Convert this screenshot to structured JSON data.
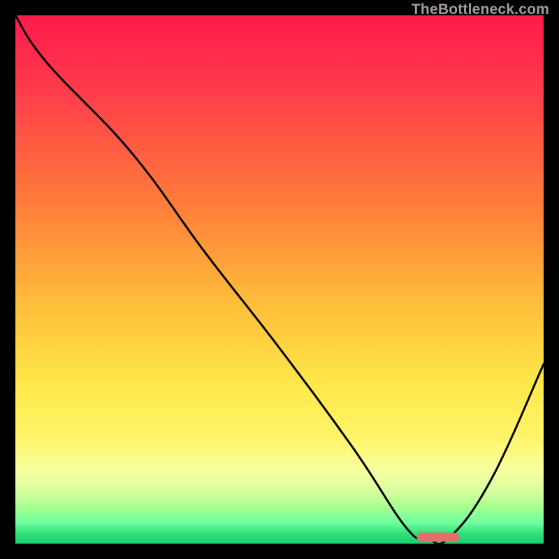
{
  "watermark": "TheBottleneck.com",
  "chart_data": {
    "type": "line",
    "title": "",
    "xlabel": "",
    "ylabel": "",
    "xlim": [
      0,
      100
    ],
    "ylim": [
      0,
      100
    ],
    "series": [
      {
        "name": "bottleneck-curve",
        "x": [
          0,
          6,
          22,
          36,
          50,
          64,
          74,
          78,
          82,
          90,
          100
        ],
        "values": [
          100,
          91,
          74,
          55,
          37,
          18,
          3,
          1,
          1,
          12,
          34
        ]
      }
    ],
    "marker": {
      "name": "target-marker",
      "x_start": 76,
      "x_end": 84,
      "y": 1.2,
      "color": "#e26f69"
    },
    "gradient_stops": [
      {
        "pos": 0,
        "color": "#ff1a4d"
      },
      {
        "pos": 35,
        "color": "#ff7a3a"
      },
      {
        "pos": 70,
        "color": "#ffe84a"
      },
      {
        "pos": 90,
        "color": "#d8ffa0"
      },
      {
        "pos": 100,
        "color": "#16d070"
      }
    ],
    "grid": false,
    "legend": false
  }
}
